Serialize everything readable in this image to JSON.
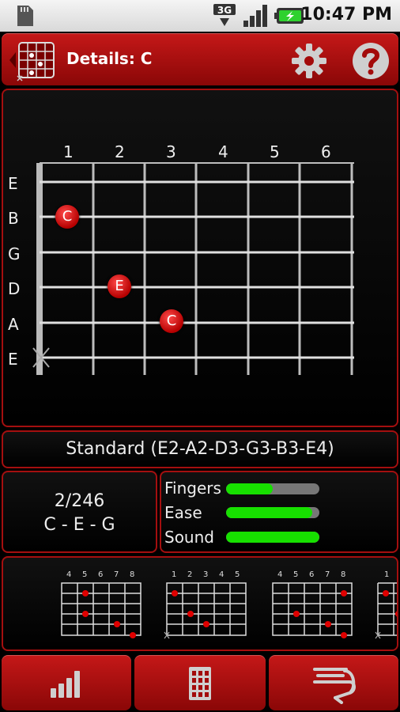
{
  "status_bar": {
    "time": "10:47 PM",
    "network": "3G",
    "icons": [
      "sd-card-icon",
      "network-3g-icon",
      "signal-icon",
      "battery-charging-icon"
    ]
  },
  "header": {
    "title": "Details: C",
    "icons": [
      "chord-grid-icon",
      "gear-icon",
      "help-icon"
    ]
  },
  "fretboard": {
    "fret_numbers": [
      "1",
      "2",
      "3",
      "4",
      "5",
      "6"
    ],
    "string_names": [
      "E",
      "B",
      "G",
      "D",
      "A",
      "E"
    ],
    "notes": [
      {
        "label": "C",
        "string": "B",
        "fret": 1
      },
      {
        "label": "E",
        "string": "D",
        "fret": 2
      },
      {
        "label": "C",
        "string": "A",
        "fret": 3
      }
    ],
    "muted_strings": [
      "E"
    ]
  },
  "tuning": {
    "label": "Standard (E2-A2-D3-G3-B3-E4)"
  },
  "voicing": {
    "index": "2/246",
    "notes": "C - E - G"
  },
  "metrics": [
    {
      "label": "Fingers",
      "value": 0.5
    },
    {
      "label": "Ease",
      "value": 0.92
    },
    {
      "label": "Sound",
      "value": 1.0
    }
  ],
  "alternatives": [
    {
      "fret_numbers": [
        "4",
        "5",
        "6",
        "7",
        "8"
      ]
    },
    {
      "fret_numbers": [
        "1",
        "2",
        "3",
        "4",
        "5"
      ]
    },
    {
      "fret_numbers": [
        "4",
        "5",
        "6",
        "7",
        "8"
      ]
    },
    {
      "fret_numbers": [
        "1"
      ]
    }
  ],
  "bottom_nav": {
    "icons": [
      "bar-chart-icon",
      "grid-icon",
      "capo-icon"
    ]
  }
}
